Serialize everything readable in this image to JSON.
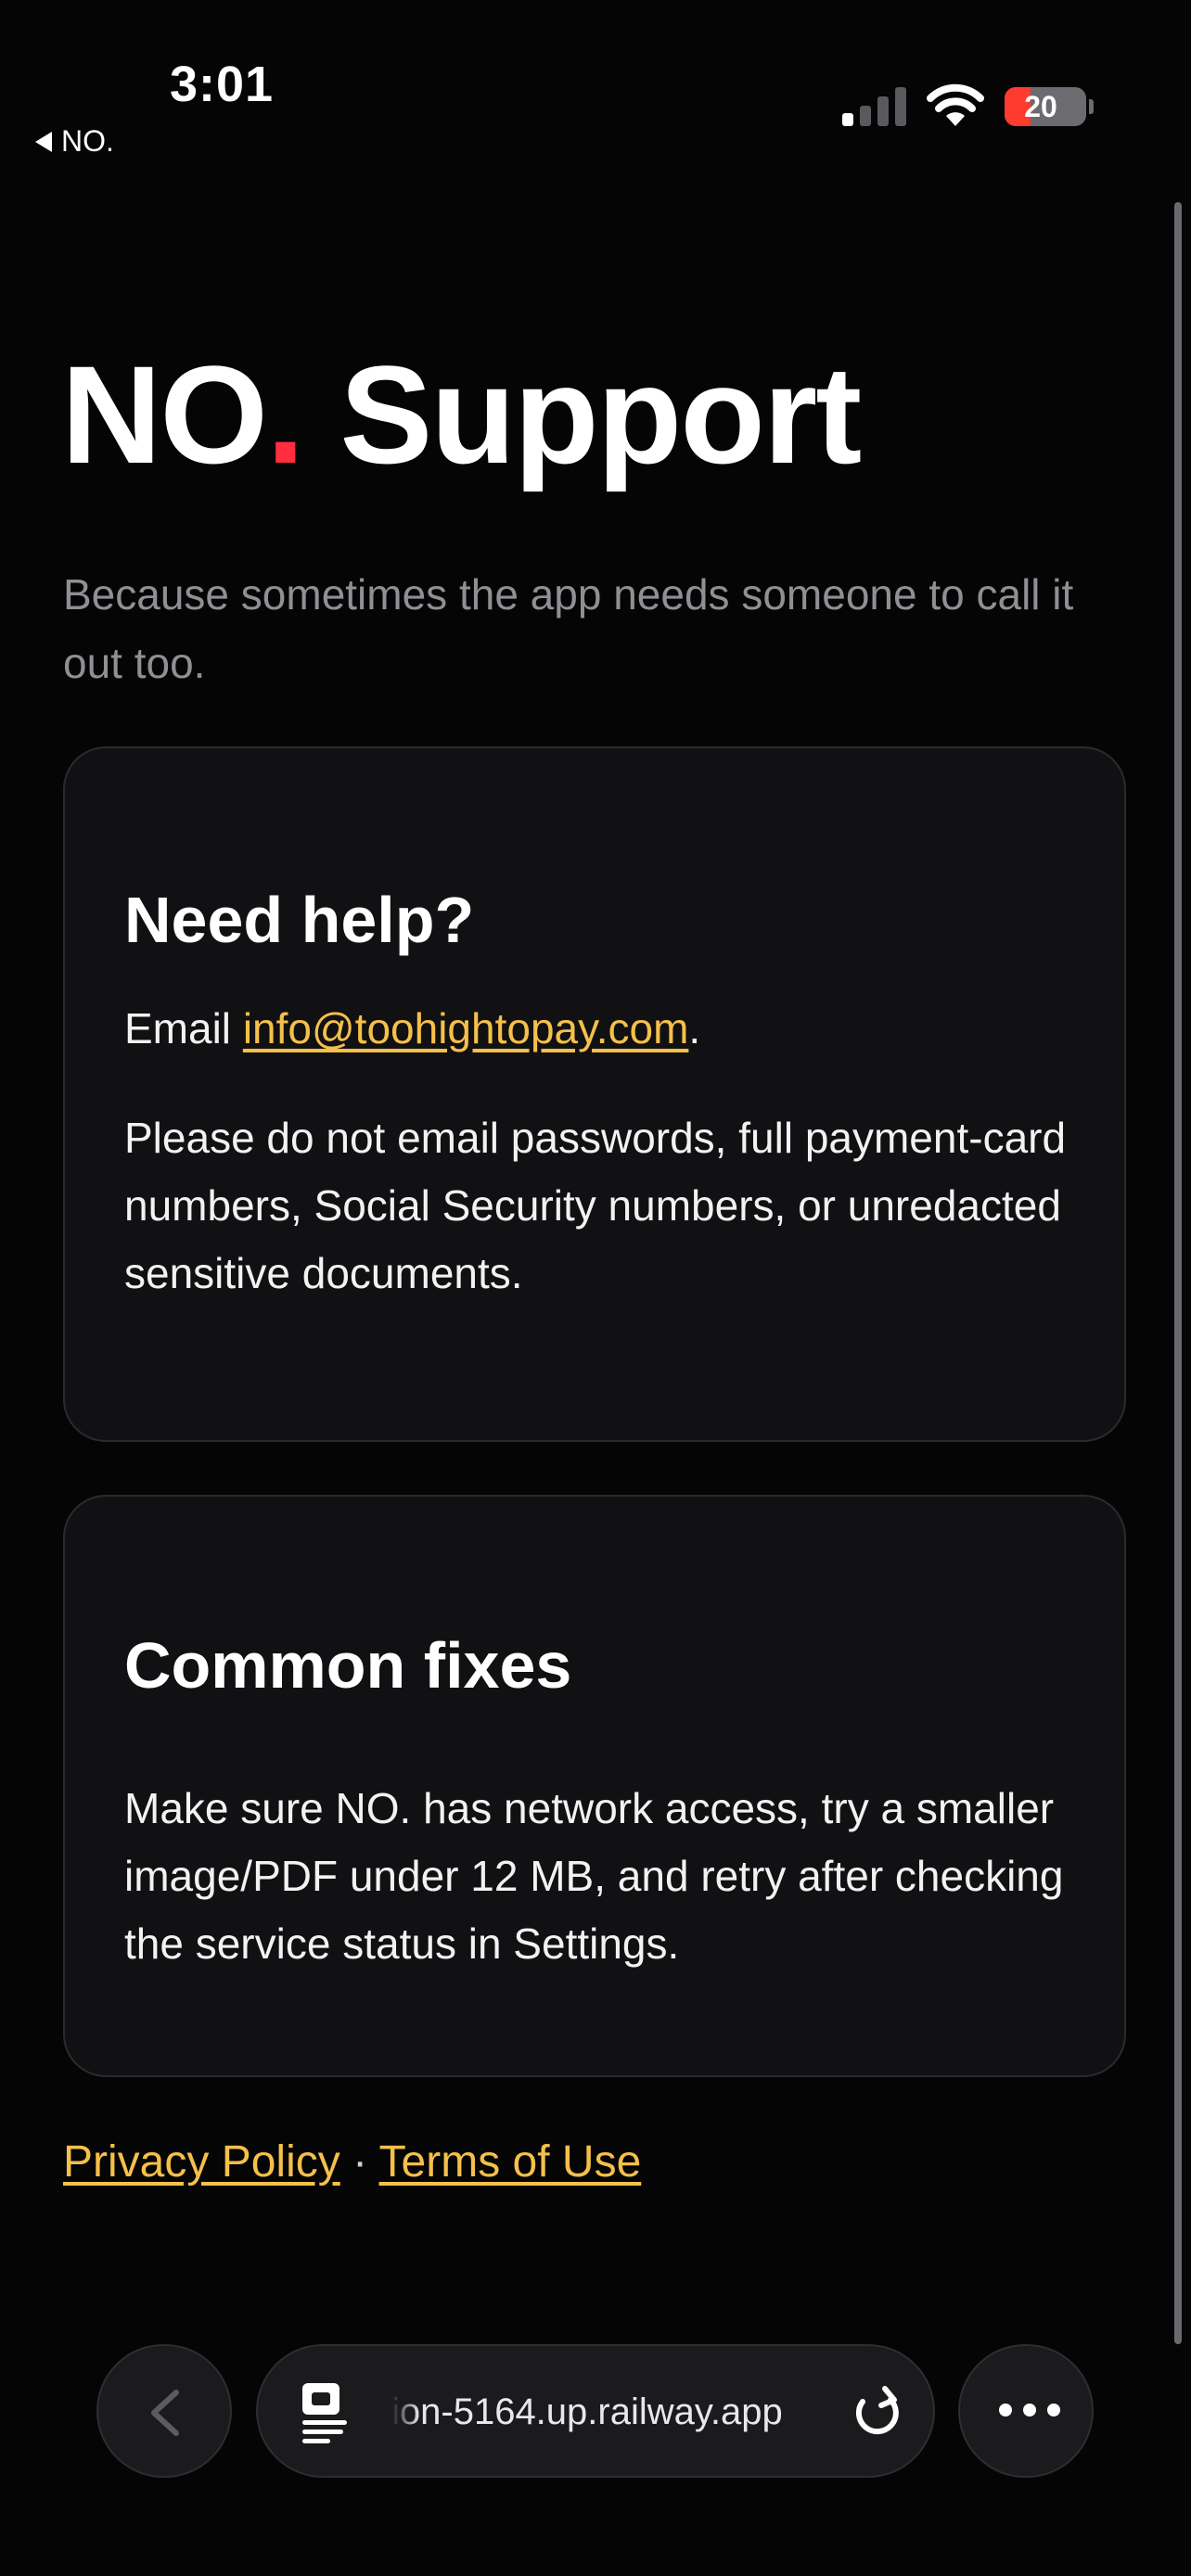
{
  "status_bar": {
    "time": "3:01",
    "back_app": "NO.",
    "battery_level": "20",
    "battery_fraction": 0.2,
    "battery_color": "#ff3b30"
  },
  "page": {
    "brand": "NO",
    "brand_dot": ".",
    "title_rest": " Support",
    "subtitle": "Because sometimes the app needs someone to call it out too."
  },
  "help_card": {
    "heading": "Need help?",
    "email_prefix": "Email ",
    "email": "info@toohightopay.com",
    "email_suffix": ".",
    "warning": "Please do not email passwords, full payment-card numbers, Social Security numbers, or unredacted sensitive documents."
  },
  "fixes_card": {
    "heading": "Common fixes",
    "text": "Make sure NO. has network access, try a smaller image/PDF under 12 MB, and retry after checking the service status in Settings."
  },
  "footer": {
    "privacy": "Privacy Policy",
    "separator": " · ",
    "terms": "Terms of Use"
  },
  "browser": {
    "url": "ion-5164.up.railway.app"
  },
  "colors": {
    "background": "#050506",
    "accent_dot": "#ff2d3f",
    "link": "#f5c04a",
    "card": "#111113"
  }
}
